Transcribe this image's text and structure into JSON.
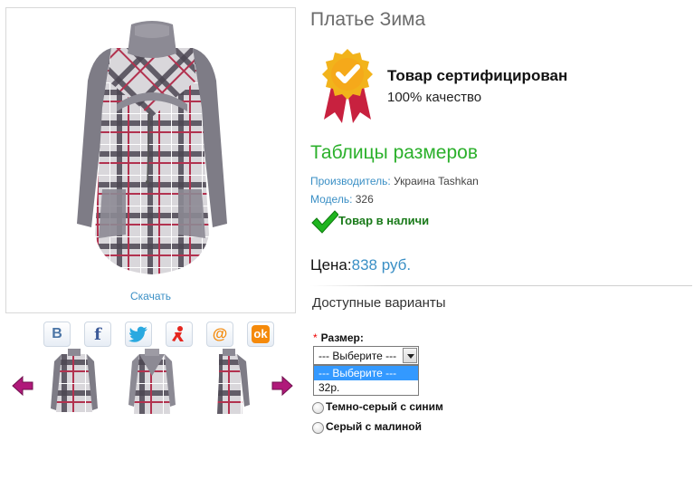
{
  "gallery": {
    "download_label": "Скачать",
    "thumbnails": [
      "dress-front",
      "dress-back",
      "dress-side"
    ]
  },
  "share": {
    "vk_glyph": "B",
    "fb_glyph": "f",
    "mail_glyph": "@",
    "ok_glyph": "ok"
  },
  "product": {
    "title": "Платье Зима",
    "certificate": {
      "title": "Товар сертифицирован",
      "subtitle": "100% качество"
    },
    "size_table_label": "Таблицы размеров",
    "manufacturer_key": "Производитель:",
    "manufacturer_value": " Украина Tashkan",
    "model_key": "Модель:",
    "model_value": " 326",
    "stock_label": "Товар в наличи",
    "price_key": "Цена:",
    "price_value": "838 руб."
  },
  "options": {
    "heading": "Доступные варианты",
    "size_label": "Размер:",
    "required_mark": "*",
    "select_value": "--- Выберите ---",
    "select_options": [
      "--- Выберите ---",
      "32р."
    ],
    "color_variants": [
      "Темно-серый с синим",
      "Серый с малиной"
    ]
  },
  "colors": {
    "accent_blue": "#3a8fc5",
    "accent_green": "#2bb02b",
    "stock_green": "#1a7a1a",
    "badge_gold": "#f2b31b",
    "ribbon_red": "#c8213f",
    "arrow_magenta": "#b0197a"
  }
}
